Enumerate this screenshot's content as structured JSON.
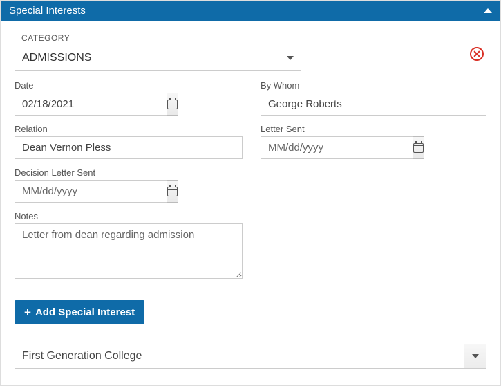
{
  "panel": {
    "title": "Special Interests"
  },
  "category": {
    "label": "CATEGORY",
    "value": "ADMISSIONS"
  },
  "fields": {
    "date": {
      "label": "Date",
      "value": "02/18/2021"
    },
    "byWhom": {
      "label": "By Whom",
      "value": "George Roberts"
    },
    "relation": {
      "label": "Relation",
      "value": "Dean Vernon Pless"
    },
    "letterSent": {
      "label": "Letter Sent",
      "placeholder": "MM/dd/yyyy"
    },
    "decisionLetterSent": {
      "label": "Decision Letter Sent",
      "placeholder": "MM/dd/yyyy"
    },
    "notes": {
      "label": "Notes",
      "value": "Letter from dean regarding admission"
    }
  },
  "addButton": {
    "label": "Add Special Interest"
  },
  "bottomSelect": {
    "value": "First Generation College"
  }
}
